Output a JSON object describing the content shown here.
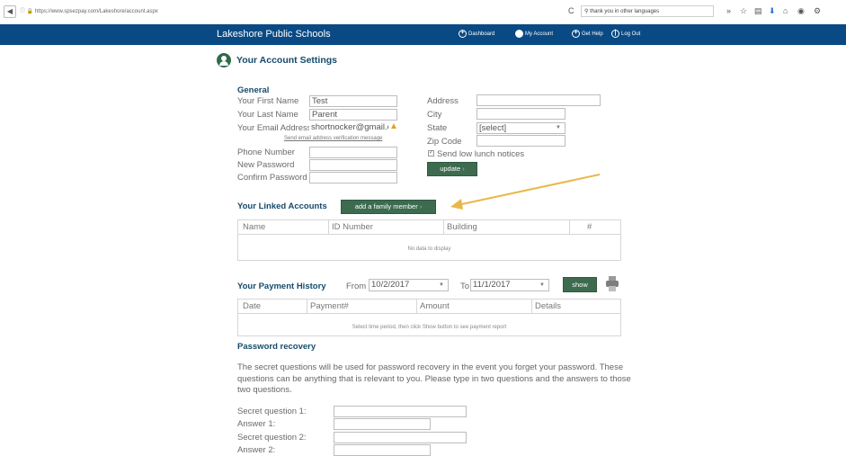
{
  "browser": {
    "url": "https://www.spsezpay.com/Lakeshore/account.aspx",
    "search_text": "thank you in other languages",
    "refresh_glyph": "C"
  },
  "header": {
    "brand": "Lakeshore Public Schools",
    "nav": [
      {
        "label": "Dashboard",
        "icon": "dashboard-icon"
      },
      {
        "label": "My Account",
        "icon": "user-icon"
      },
      {
        "label": "Get Help",
        "icon": "help-icon"
      },
      {
        "label": "Log Out",
        "icon": "power-icon"
      }
    ]
  },
  "page": {
    "title": "Your Account Settings"
  },
  "general": {
    "heading": "General",
    "first_name_label": "Your First Name",
    "first_name_value": "Test",
    "last_name_label": "Your Last Name",
    "last_name_value": "Parent",
    "email_label": "Your Email Address",
    "email_value": "shortnocker@gmail.cor",
    "verify_link": "Send email address verification message",
    "phone_label": "Phone Number",
    "password_label": "New Password",
    "confirm_label": "Confirm Password",
    "address_label": "Address",
    "city_label": "City",
    "state_label": "State",
    "state_value": "[select]",
    "zip_label": "Zip Code",
    "notices_label": "Send low lunch notices",
    "update_label": "update"
  },
  "linked": {
    "heading": "Your Linked Accounts",
    "add_label": "add a family member",
    "columns": [
      "Name",
      "ID Number",
      "Building",
      "#"
    ],
    "empty": "No data to display"
  },
  "payments": {
    "heading": "Your Payment History",
    "from_label": "From",
    "from_value": "10/2/2017",
    "to_label": "To",
    "to_value": "11/1/2017",
    "show_label": "show",
    "columns": [
      "Date",
      "Payment#",
      "Amount",
      "Details"
    ],
    "empty": "Select time period, then click Show button to see payment report"
  },
  "recovery": {
    "heading": "Password recovery",
    "text": "The secret questions will be used for password recovery in the event you forget your password. These questions can be anything that is relevant to you. Please type in two questions and the answers to those two questions.",
    "q1_label": "Secret question 1:",
    "a1_label": "Answer 1:",
    "q2_label": "Secret question 2:",
    "a2_label": "Answer 2:"
  },
  "colors": {
    "appbar": "#0a4a84",
    "button": "#3d6b4f",
    "heading": "#154a6b",
    "arrow": "#e8b84a"
  }
}
